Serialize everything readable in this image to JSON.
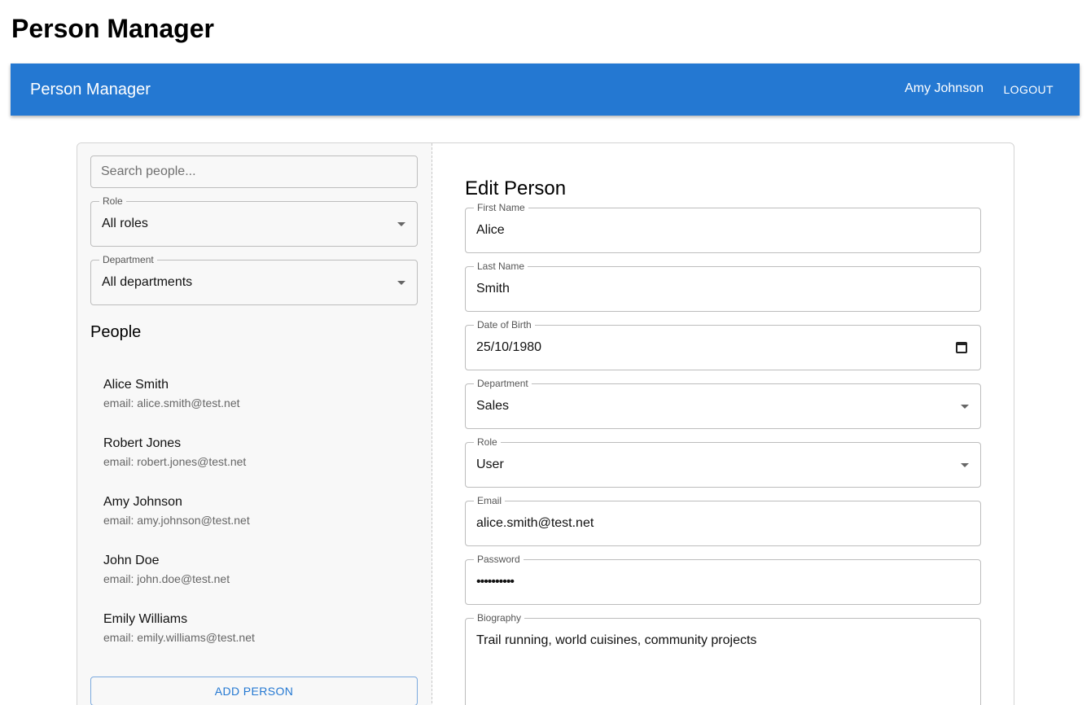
{
  "page": {
    "title": "Person Manager"
  },
  "appbar": {
    "brand": "Person Manager",
    "user": "Amy Johnson",
    "logout": "LOGOUT",
    "color": "#2478d2"
  },
  "filters": {
    "search_placeholder": "Search people...",
    "role": {
      "label": "Role",
      "value": "All roles"
    },
    "department": {
      "label": "Department",
      "value": "All departments"
    }
  },
  "people": {
    "heading": "People",
    "items": [
      {
        "name": "Alice Smith",
        "email": "email: alice.smith@test.net"
      },
      {
        "name": "Robert Jones",
        "email": "email: robert.jones@test.net"
      },
      {
        "name": "Amy Johnson",
        "email": "email: amy.johnson@test.net"
      },
      {
        "name": "John Doe",
        "email": "email: john.doe@test.net"
      },
      {
        "name": "Emily Williams",
        "email": "email: emily.williams@test.net"
      }
    ],
    "add_label": "ADD PERSON"
  },
  "edit": {
    "heading": "Edit Person",
    "first_name": {
      "label": "First Name",
      "value": "Alice"
    },
    "last_name": {
      "label": "Last Name",
      "value": "Smith"
    },
    "dob": {
      "label": "Date of Birth",
      "value": "25/10/1980"
    },
    "department": {
      "label": "Department",
      "value": "Sales"
    },
    "role": {
      "label": "Role",
      "value": "User"
    },
    "email": {
      "label": "Email",
      "value": "alice.smith@test.net"
    },
    "password": {
      "label": "Password",
      "value": "••••••••••"
    },
    "biography": {
      "label": "Biography",
      "value": "Trail running, world cuisines, community projects"
    }
  }
}
